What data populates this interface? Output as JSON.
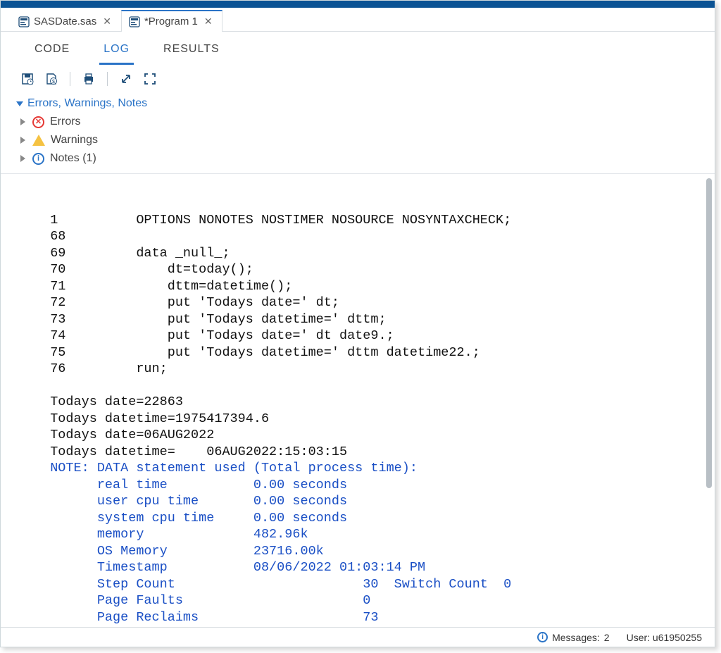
{
  "file_tabs": [
    {
      "label": "SASDate.sas",
      "active": false
    },
    {
      "label": "*Program 1",
      "active": true
    }
  ],
  "view_tabs": {
    "code": "CODE",
    "log": "LOG",
    "results": "RESULTS",
    "active": "log"
  },
  "log_summary": {
    "header": "Errors, Warnings, Notes",
    "errors_label": "Errors",
    "warnings_label": "Warnings",
    "notes_label": "Notes (1)"
  },
  "log_text_plain": "  1          OPTIONS NONOTES NOSTIMER NOSOURCE NOSYNTAXCHECK;\n  68         \n  69         data _null_;\n  70             dt=today();\n  71             dttm=datetime();\n  72             put 'Todays date=' dt;\n  73             put 'Todays datetime=' dttm;\n  74             put 'Todays date=' dt date9.;\n  75             put 'Todays datetime=' dttm datetime22.;\n  76         run;\n  \n  Todays date=22863\n  Todays datetime=1975417394.6\n  Todays date=06AUG2022\n  Todays datetime=    06AUG2022:15:03:15",
  "log_text_note": "  NOTE: DATA statement used (Total process time):\n        real time           0.00 seconds\n        user cpu time       0.00 seconds\n        system cpu time     0.00 seconds\n        memory              482.96k\n        OS Memory           23716.00k\n        Timestamp           08/06/2022 01:03:14 PM\n        Step Count                        30  Switch Count  0\n        Page Faults                       0\n        Page Reclaims                     73",
  "status": {
    "messages_label": "Messages:",
    "messages_count": "2",
    "user_label": "User:",
    "user_value": "u61950255"
  }
}
